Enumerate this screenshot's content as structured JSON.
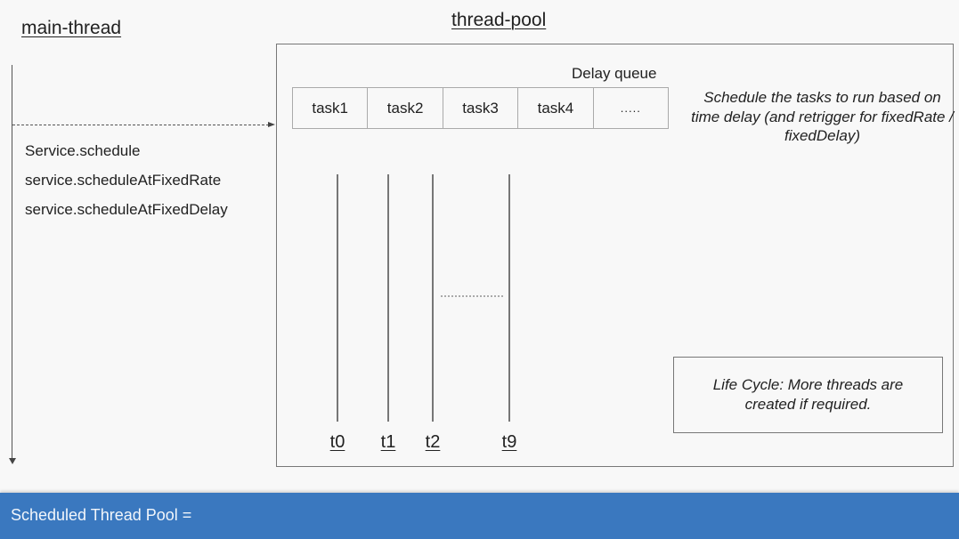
{
  "headings": {
    "main_thread": "main-thread",
    "thread_pool": "thread-pool"
  },
  "main_thread": {
    "methods": [
      "Service.schedule",
      "service.scheduleAtFixedRate",
      "service.scheduleAtFixedDelay"
    ]
  },
  "pool": {
    "queue_label": "Delay queue",
    "queue_cells": [
      "task1",
      "task2",
      "task3",
      "task4",
      "....."
    ],
    "schedule_note": "Schedule the tasks to run based on time delay (and retrigger for fixedRate / fixedDelay)",
    "threads": [
      "t0",
      "t1",
      "t2",
      "t9"
    ],
    "lifecycle_note": "Life Cycle: More threads are created if required."
  },
  "footer": {
    "title": "Scheduled Thread Pool =",
    "color": "#3a78bf"
  }
}
